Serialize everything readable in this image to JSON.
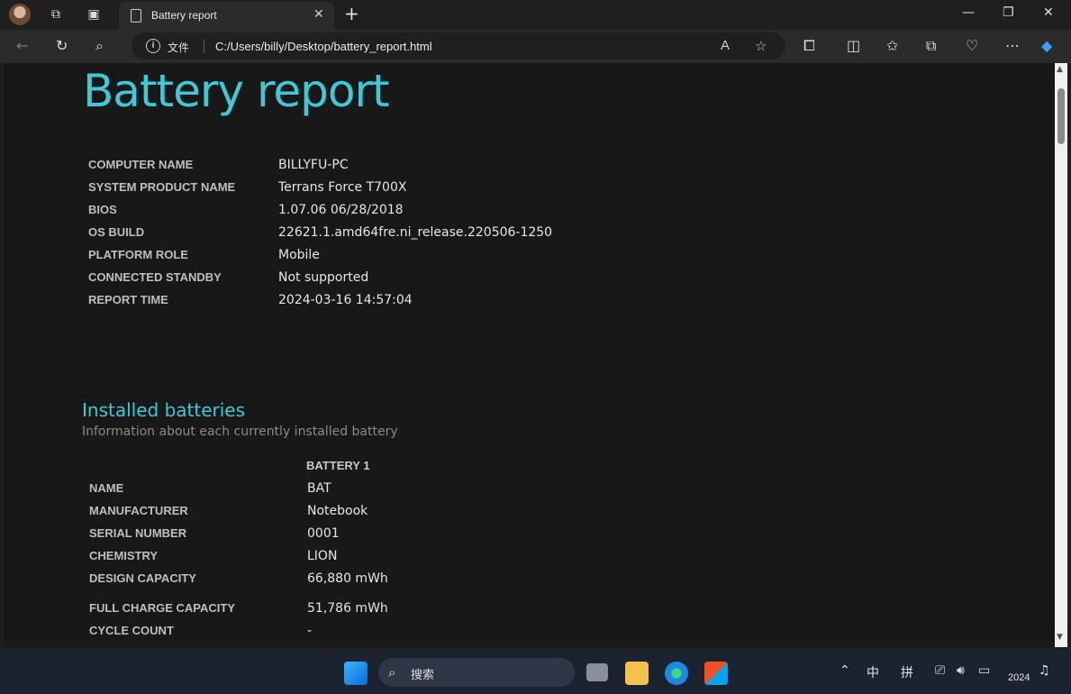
{
  "browser": {
    "tab_title": "Battery report",
    "address_label": "文件",
    "url": "C:/Users/billy/Desktop/battery_report.html"
  },
  "report": {
    "title": "Battery report",
    "system_info": [
      {
        "key": "COMPUTER NAME",
        "value": "BILLYFU-PC"
      },
      {
        "key": "SYSTEM PRODUCT NAME",
        "value": "Terrans Force T700X"
      },
      {
        "key": "BIOS",
        "value": "1.07.06 06/28/2018"
      },
      {
        "key": "OS BUILD",
        "value": "22621.1.amd64fre.ni_release.220506-1250"
      },
      {
        "key": "PLATFORM ROLE",
        "value": "Mobile"
      },
      {
        "key": "CONNECTED STANDBY",
        "value": "Not supported"
      },
      {
        "key": "REPORT TIME",
        "value": "2024-03-16  14:57:04"
      }
    ],
    "installed_batteries": {
      "heading": "Installed batteries",
      "subheading": "Information about each currently installed battery",
      "column_header": "BATTERY 1",
      "rows": [
        {
          "key": "NAME",
          "value": "BAT"
        },
        {
          "key": "MANUFACTURER",
          "value": "Notebook"
        },
        {
          "key": "SERIAL NUMBER",
          "value": "0001"
        },
        {
          "key": "CHEMISTRY",
          "value": "LION"
        },
        {
          "key": "DESIGN CAPACITY",
          "value": "66,880 mWh"
        },
        {
          "key": "FULL CHARGE CAPACITY",
          "value": "51,786 mWh"
        },
        {
          "key": "CYCLE COUNT",
          "value": "-"
        }
      ]
    }
  },
  "taskbar": {
    "search_label": "搜索",
    "ime_mode": "中",
    "ime_pinyin": "拼",
    "clock": "2024"
  },
  "colors": {
    "accent": "#3dc9d6",
    "page_bg": "#181818",
    "chrome_bg": "#2b2b2b"
  }
}
